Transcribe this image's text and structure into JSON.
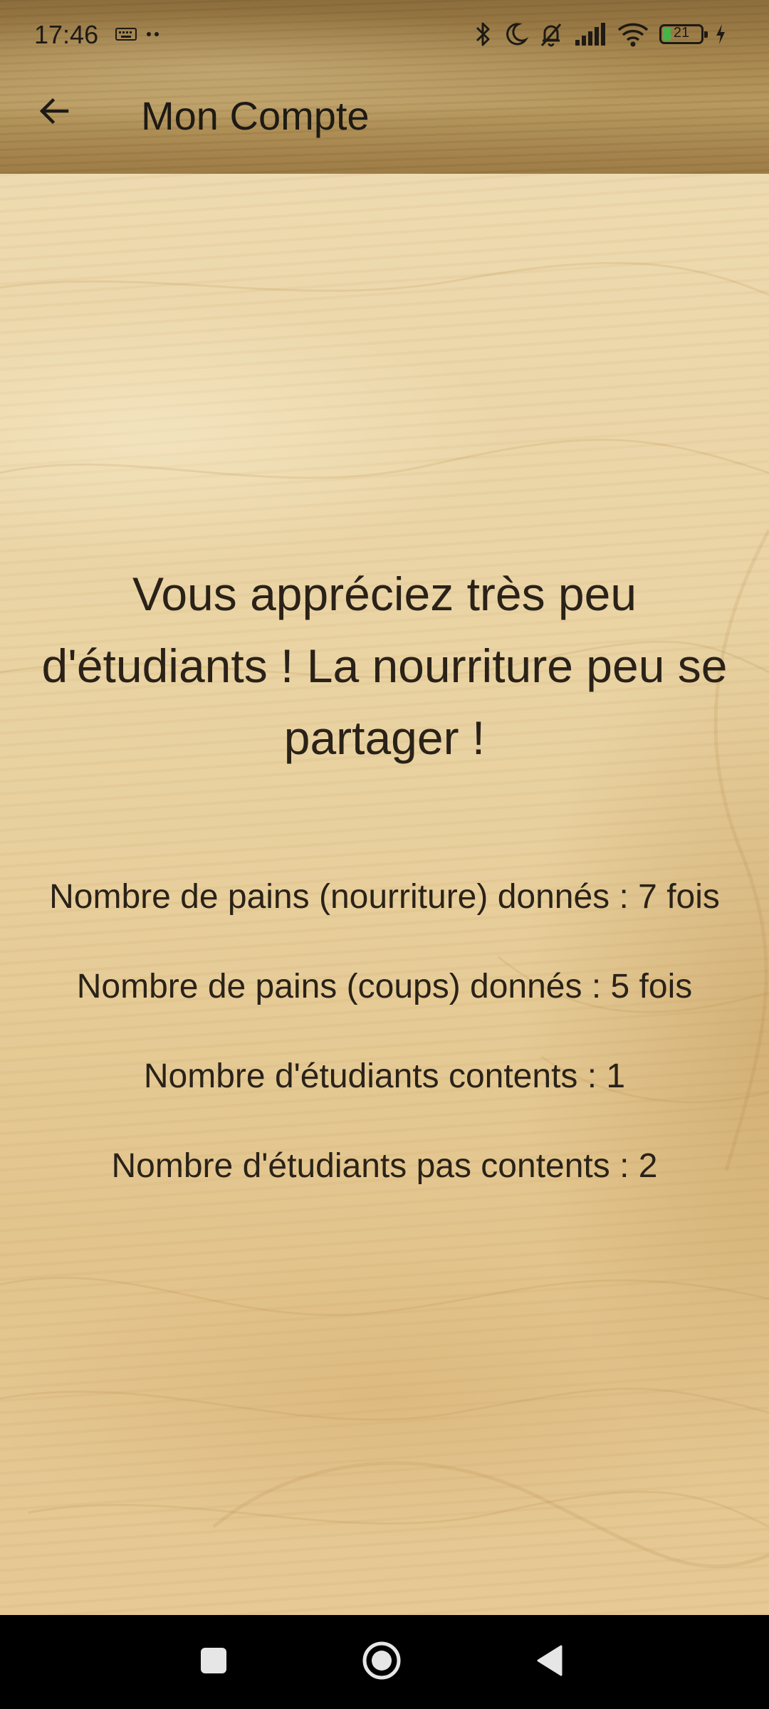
{
  "status_bar": {
    "time": "17:46",
    "left_icons": [
      "keyboard-icon",
      "more-dots-icon"
    ],
    "right_icons": [
      "bluetooth-icon",
      "moon-icon",
      "bell-off-icon",
      "signal-icon",
      "wifi-icon",
      "battery-icon",
      "charging-icon"
    ],
    "battery_level": "21",
    "battery_color": "#45b449"
  },
  "app_bar": {
    "title": "Mon Compte",
    "back_icon": "arrow-back-icon"
  },
  "main": {
    "message_lines": [
      "Vous appréciez très peu",
      "d'étudiants ! La nourriture peu se",
      "partager !"
    ],
    "stats": [
      "Nombre de pains (nourriture) donnés : 7 fois",
      "Nombre de pains (coups) donnés : 5 fois",
      "Nombre d'étudiants contents : 1",
      "Nombre d'étudiants pas contents : 2"
    ]
  },
  "nav_bar": {
    "buttons": [
      "recents-square-icon",
      "home-circle-icon",
      "back-triangle-icon"
    ]
  }
}
